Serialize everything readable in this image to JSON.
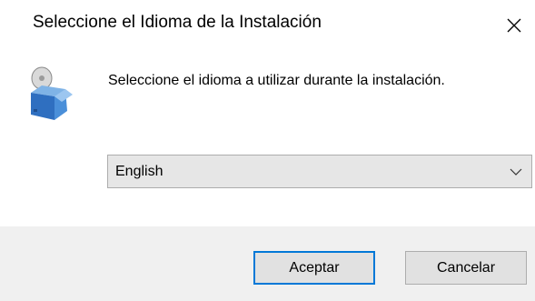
{
  "window": {
    "title": "Seleccione el Idioma de la Instalación"
  },
  "title_bar": {
    "close_icon": "close-icon"
  },
  "content": {
    "app_icon": "installer-box-with-disc-icon",
    "message": "Seleccione el idioma a utilizar durante la instalación."
  },
  "language_select": {
    "selected": "English",
    "arrow_icon": "chevron-down-icon"
  },
  "buttons": {
    "ok_label": "Aceptar",
    "cancel_label": "Cancelar"
  },
  "colors": {
    "accent_focus": "#0078d7",
    "footer_bg": "#f0f0f0",
    "combo_bg": "#e6e6e6",
    "button_bg": "#e1e1e1",
    "border": "#adadad"
  }
}
